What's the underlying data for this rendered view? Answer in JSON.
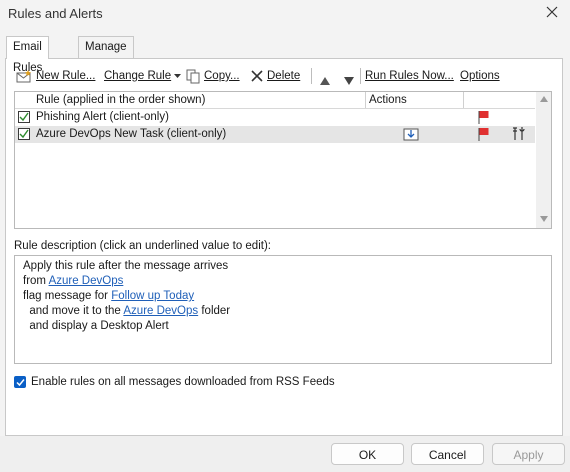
{
  "window": {
    "title": "Rules and Alerts"
  },
  "tabs": [
    {
      "label": "Email Rules",
      "active": true
    },
    {
      "label": "Manage Alerts",
      "active": false
    }
  ],
  "toolbar": {
    "new_rule": "New Rule...",
    "change_rule": "Change Rule",
    "copy": "Copy...",
    "delete": "Delete",
    "run_rules_now": "Run Rules Now...",
    "options": "Options"
  },
  "rules_table": {
    "col_rule": "Rule (applied in the order shown)",
    "col_actions": "Actions",
    "rows": [
      {
        "name": "Phishing Alert  (client-only)",
        "enabled": true,
        "selected": false
      },
      {
        "name": "Azure DevOps New Task  (client-only)",
        "enabled": true,
        "selected": true
      }
    ]
  },
  "description": {
    "label": "Rule description (click an underlined value to edit):",
    "line1": "Apply this rule after the message arrives",
    "line2_prefix": "from ",
    "line2_link": "Azure DevOps",
    "line3_prefix": "flag message for ",
    "line3_link": "Follow up Today",
    "line4_prefix": "  and move it to the ",
    "line4_link": "Azure DevOps",
    "line4_suffix": " folder",
    "line5": "  and display a Desktop Alert"
  },
  "rss": {
    "label": "Enable rules on all messages downloaded from RSS Feeds",
    "checked": true
  },
  "buttons": {
    "ok": "OK",
    "cancel": "Cancel",
    "apply": "Apply"
  },
  "colors": {
    "accent": "#0a5fc6",
    "link": "#1f5fb8",
    "flag": "#e03030",
    "check": "#2e8b2e"
  }
}
